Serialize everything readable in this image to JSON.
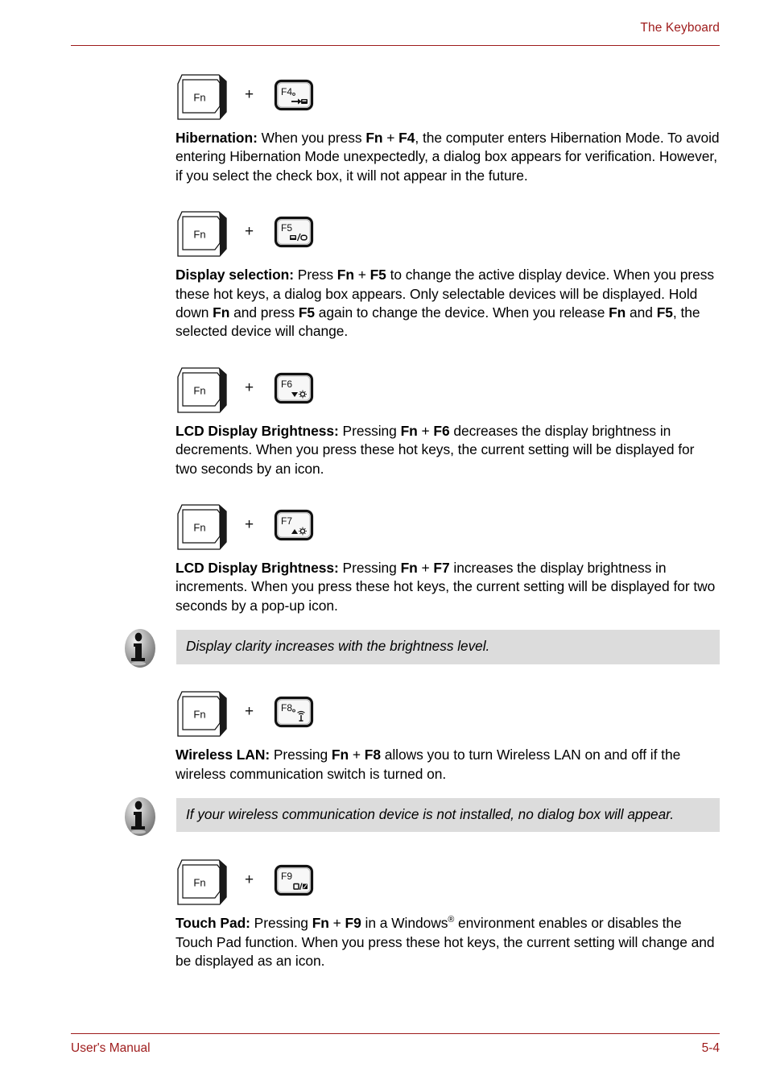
{
  "header": {
    "title": "The Keyboard",
    "rule_color": "#9e1b1b"
  },
  "footer": {
    "left_label": "User's Manual",
    "page_number": "5-4",
    "rule_color": "#9e1b1b"
  },
  "keycaps": {
    "fn_label": "Fn",
    "plus": "+"
  },
  "sections": [
    {
      "key_combo": {
        "modifier": "Fn",
        "plus": "+",
        "function_key": "F4",
        "icon_name": "hibernation-icon"
      },
      "heading": "Hibernation:",
      "body_html": " When you press <b>Fn</b> + <b>F4</b>, the computer enters Hibernation Mode. To avoid entering Hibernation Mode unexpectedly, a dialog box appears for verification. However, if you select the check box, it will not appear in the future."
    },
    {
      "key_combo": {
        "modifier": "Fn",
        "plus": "+",
        "function_key": "F5",
        "icon_name": "display-selection-icon"
      },
      "heading": "Display selection:",
      "body_html": " Press <b>Fn</b> + <b>F5</b> to change the active display device. When you press these hot keys, a dialog box appears. Only selectable devices will be displayed. Hold down <b>Fn</b> and press <b>F5</b> again to change the device. When you release <b>Fn</b> and <b>F5</b>, the selected device will change."
    },
    {
      "key_combo": {
        "modifier": "Fn",
        "plus": "+",
        "function_key": "F6",
        "icon_name": "brightness-decrease-icon"
      },
      "heading": "LCD Display Brightness:",
      "body_html": " Pressing <b>Fn</b> + <b>F6</b> decreases the display brightness in decrements. When you press these hot keys, the current setting will be displayed for two seconds by an icon."
    },
    {
      "key_combo": {
        "modifier": "Fn",
        "plus": "+",
        "function_key": "F7",
        "icon_name": "brightness-increase-icon"
      },
      "heading": "LCD Display Brightness:",
      "body_html": " Pressing <b>Fn</b> + <b>F7</b> increases the display brightness in increments. When you press these hot keys, the current setting will be displayed for two seconds by a pop-up icon."
    },
    {
      "key_combo": {
        "modifier": "Fn",
        "plus": "+",
        "function_key": "F8",
        "icon_name": "wireless-lan-icon"
      },
      "heading": "Wireless LAN:",
      "body_html": " Pressing <b>Fn</b> + <b>F8</b> allows you to turn Wireless LAN on and off if the wireless communication switch is turned on."
    },
    {
      "key_combo": {
        "modifier": "Fn",
        "plus": "+",
        "function_key": "F9",
        "icon_name": "touch-pad-icon"
      },
      "heading": "Touch Pad:",
      "body_html": " Pressing <b>Fn</b> + <b>F9</b> in a Windows<sup>&#174;</sup> environment enables or disables the Touch Pad function. When you press these hot keys, the current setting will change and be displayed as an icon."
    }
  ],
  "notes": [
    {
      "icon_name": "info-icon",
      "text": "Display clarity increases with the brightness level."
    },
    {
      "icon_name": "info-icon",
      "text": "If your wireless communication device is not installed, no dialog box will appear."
    }
  ]
}
